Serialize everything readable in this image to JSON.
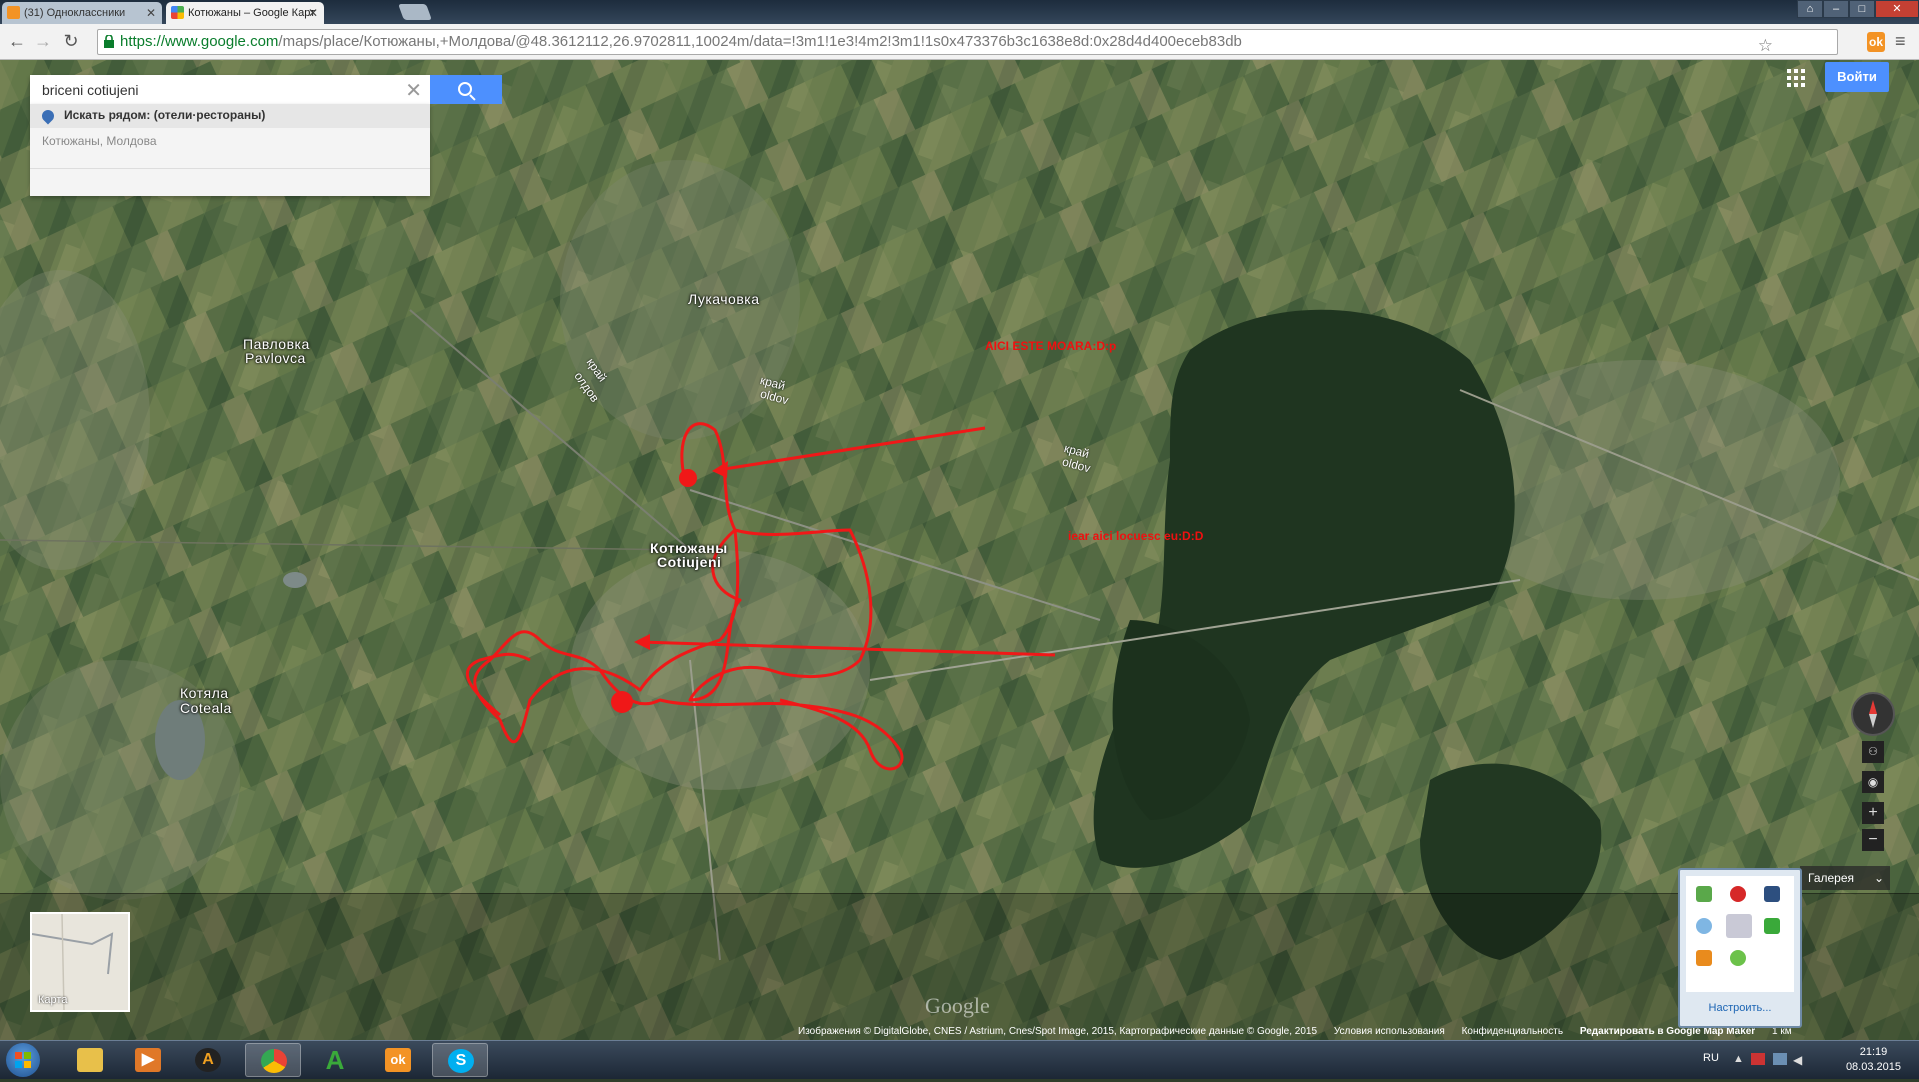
{
  "browser": {
    "tabs": [
      {
        "title": "(31) Одноклассники",
        "active": false,
        "favicon": "odnoklassniki-icon",
        "color": "#f39325"
      },
      {
        "title": "Котюжаны – Google Карт",
        "active": true,
        "favicon": "google-maps-icon",
        "color": "#4caf50"
      }
    ],
    "url_scheme_host": "https://www.google.com",
    "url_path": "/maps/place/Котюжаны,+Молдова/@48.3612112,26.9702811,10024m/data=!3m1!1e3!4m2!3m1!1s0x473376b3c1638e8d:0x28d4d400eceb83db"
  },
  "maps": {
    "search_value": "briceni cotiujeni",
    "suggestion_nearby": "Искать рядом: (отели·рестораны)",
    "suggestion_place": "Котюжаны",
    "suggestion_place_region": ", Молдова",
    "signin_label": "Войти",
    "minimap_label": "Карта",
    "gallery_label": "Галерея",
    "google_logo": "Google",
    "footer": {
      "attribution": "Изображения © DigitalGlobe, CNES / Astrium, Cnes/Spot Image, 2015, Картографические данные © Google, 2015",
      "terms": "Условия использования",
      "privacy": "Конфиденциальность",
      "edit": "Редактировать в Google Map Maker",
      "scale": "1 км"
    },
    "place_labels": [
      {
        "ru": "Павловка",
        "ro": "Pavlovca"
      },
      {
        "ru": "Лукачовка",
        "ro": ""
      },
      {
        "ru": "Котюжаны",
        "ro": "Cotiujeni"
      },
      {
        "ru": "Котяла",
        "ro": "Coteala"
      }
    ],
    "road_labels": [
      "край",
      "олдов",
      "край",
      "oldov",
      "край",
      "oldov"
    ],
    "annotations": [
      {
        "text": "AICI ESTE MOARA:D:p",
        "color": "#f01010"
      },
      {
        "text": "iear aici locuesc eu:D:D",
        "color": "#f01010"
      }
    ],
    "zoom_in": "+",
    "zoom_out": "−"
  },
  "tray_popup": {
    "settings_label": "Настроить...",
    "icons": [
      "green-icon",
      "opera-icon",
      "monitor-icon",
      "water-icon",
      "pen-icon",
      "avast-icon",
      "media-icon",
      "green-arrows-icon"
    ]
  },
  "taskbar": {
    "items": [
      {
        "name": "explorer-icon",
        "glyph": "",
        "color": "#e8c04a"
      },
      {
        "name": "media-player-icon",
        "glyph": "▶",
        "color": "#e07828"
      },
      {
        "name": "aimp-icon",
        "glyph": "A",
        "color": "#f0a020"
      },
      {
        "name": "chrome-icon",
        "glyph": "",
        "color": "#3c9a4a",
        "active": true
      },
      {
        "name": "avast-icon",
        "glyph": "A",
        "color": "#3aa93a"
      },
      {
        "name": "odnoklassniki-icon",
        "glyph": "ok",
        "color": "#f39325"
      },
      {
        "name": "skype-icon",
        "glyph": "S",
        "color": "#00aff0",
        "active": true
      }
    ],
    "language": "RU",
    "time": "21:19",
    "date": "08.03.2015"
  }
}
